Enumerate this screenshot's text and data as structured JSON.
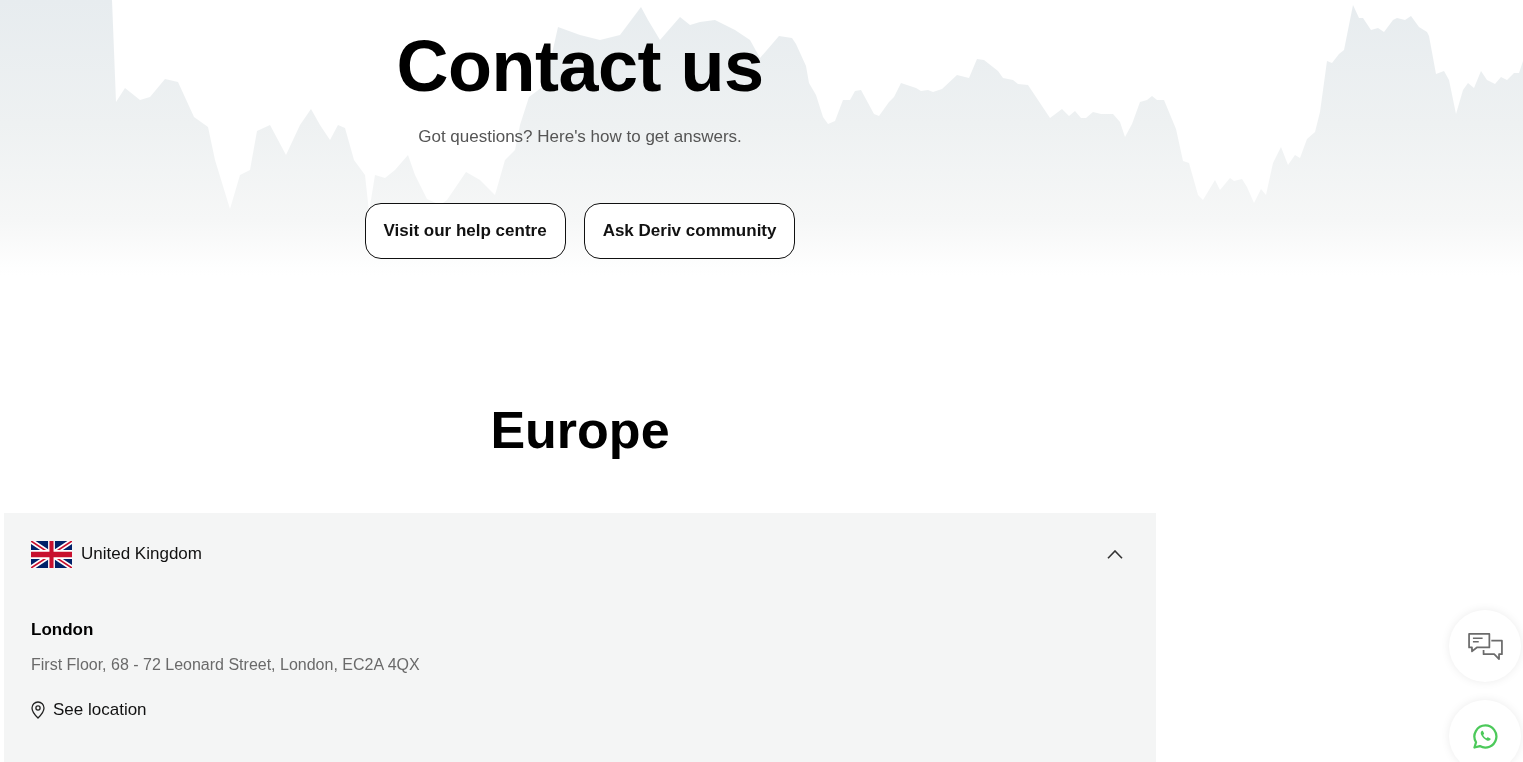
{
  "hero": {
    "title": "Contact us",
    "subtitle": "Got questions? Here's how to get answers.",
    "buttons": [
      "Visit our help centre",
      "Ask Deriv community"
    ]
  },
  "region": {
    "title": "Europe",
    "countries": [
      {
        "name": "United Kingdom",
        "expanded": true,
        "offices": [
          {
            "city": "London",
            "address": "First Floor, 68 - 72 Leonard Street, London, EC2A 4QX",
            "link": "See location"
          }
        ]
      }
    ]
  }
}
